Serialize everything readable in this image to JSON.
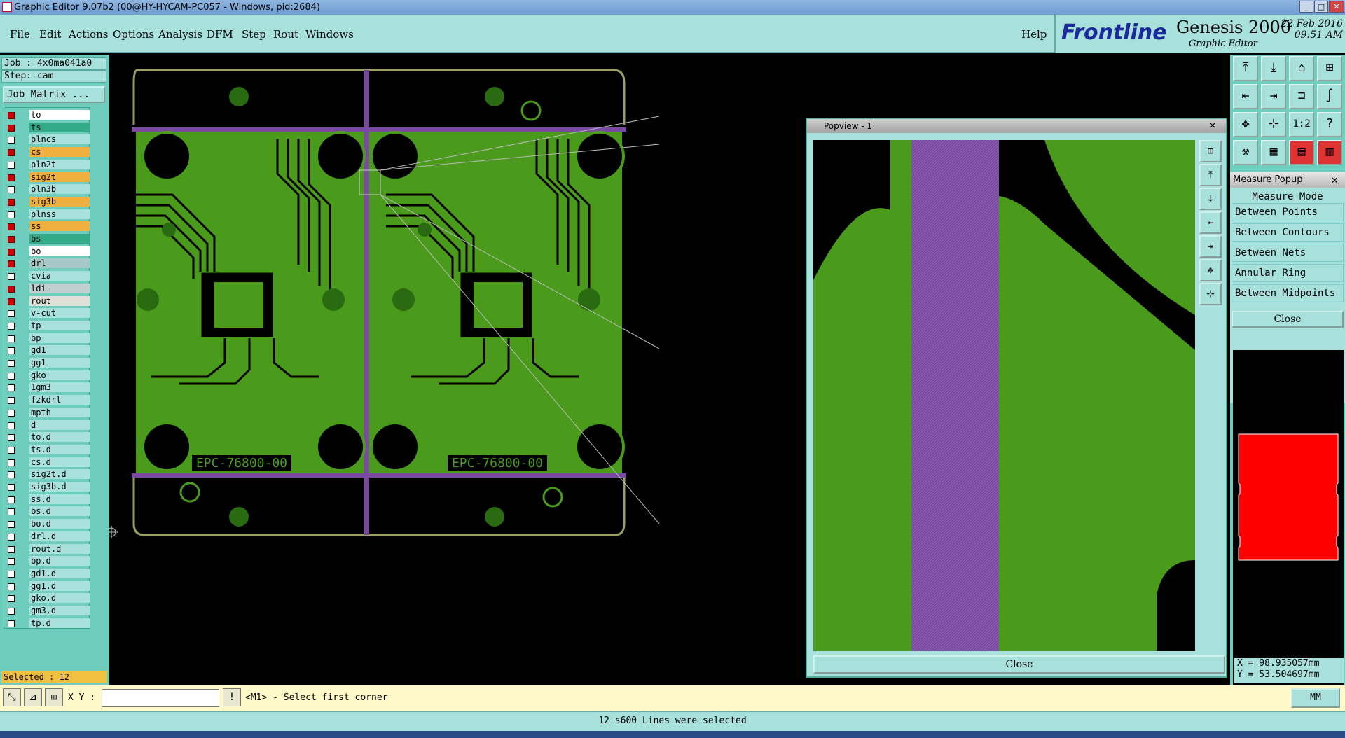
{
  "window": {
    "title": "Graphic Editor 9.07b2 (00@HY-HYCAM-PC057 - Windows, pid:2684)"
  },
  "menu": [
    "File",
    "Edit",
    "Actions",
    "Options",
    "Analysis",
    "DFM",
    "Step",
    "Rout",
    "Windows"
  ],
  "help": "Help",
  "brand": {
    "logo": "Frontline",
    "product": "Genesis 2000",
    "subtitle": "Graphic Editor",
    "date": "22 Feb 2016",
    "time": "09:51 AM"
  },
  "job": {
    "job": "Job : 4x0ma041a0",
    "step": "Step: cam",
    "matrix_btn": "Job Matrix ..."
  },
  "layers": [
    {
      "name": "to",
      "color": "#ffffff",
      "on": true
    },
    {
      "name": "ts",
      "color": "#33aa88",
      "on": true
    },
    {
      "name": "plncs",
      "color": "#a8e0dc",
      "on": false
    },
    {
      "name": "cs",
      "color": "#f0b040",
      "on": true
    },
    {
      "name": "pln2t",
      "color": "#a8e0dc",
      "on": false
    },
    {
      "name": "sig2t",
      "color": "#f0b040",
      "on": true
    },
    {
      "name": "pln3b",
      "color": "#a8e0dc",
      "on": false
    },
    {
      "name": "sig3b",
      "color": "#f0b040",
      "on": true
    },
    {
      "name": "plnss",
      "color": "#a8e0dc",
      "on": false
    },
    {
      "name": "ss",
      "color": "#f0b040",
      "on": true
    },
    {
      "name": "bs",
      "color": "#33aa88",
      "on": true
    },
    {
      "name": "bo",
      "color": "#ffffff",
      "on": true
    },
    {
      "name": "drl",
      "color": "#a8c8c8",
      "on": true
    },
    {
      "name": "cvia",
      "color": "#a8e0dc",
      "on": false
    },
    {
      "name": "ldi",
      "color": "#c0d0d0",
      "on": true
    },
    {
      "name": "rout",
      "color": "#e0e0d8",
      "on": true
    },
    {
      "name": "v-cut",
      "color": "#a8e0dc",
      "on": false
    },
    {
      "name": "tp",
      "color": "#a8e0dc",
      "on": false
    },
    {
      "name": "bp",
      "color": "#a8e0dc",
      "on": false
    },
    {
      "name": "gd1",
      "color": "#a8e0dc",
      "on": false
    },
    {
      "name": "gg1",
      "color": "#a8e0dc",
      "on": false
    },
    {
      "name": "gko",
      "color": "#a8e0dc",
      "on": false
    },
    {
      "name": "1gm3",
      "color": "#a8e0dc",
      "on": false
    },
    {
      "name": "fzkdrl",
      "color": "#a8e0dc",
      "on": false
    },
    {
      "name": "mpth",
      "color": "#a8e0dc",
      "on": false
    },
    {
      "name": "d",
      "color": "#a8e0dc",
      "on": false
    },
    {
      "name": "to.d",
      "color": "#a8e0dc",
      "on": false
    },
    {
      "name": "ts.d",
      "color": "#a8e0dc",
      "on": false
    },
    {
      "name": "cs.d",
      "color": "#a8e0dc",
      "on": false
    },
    {
      "name": "sig2t.d",
      "color": "#a8e0dc",
      "on": false
    },
    {
      "name": "sig3b.d",
      "color": "#a8e0dc",
      "on": false
    },
    {
      "name": "ss.d",
      "color": "#a8e0dc",
      "on": false
    },
    {
      "name": "bs.d",
      "color": "#a8e0dc",
      "on": false
    },
    {
      "name": "bo.d",
      "color": "#a8e0dc",
      "on": false
    },
    {
      "name": "drl.d",
      "color": "#a8e0dc",
      "on": false
    },
    {
      "name": "rout.d",
      "color": "#a8e0dc",
      "on": false
    },
    {
      "name": "bp.d",
      "color": "#a8e0dc",
      "on": false
    },
    {
      "name": "gd1.d",
      "color": "#a8e0dc",
      "on": false
    },
    {
      "name": "gg1.d",
      "color": "#a8e0dc",
      "on": false
    },
    {
      "name": "gko.d",
      "color": "#a8e0dc",
      "on": false
    },
    {
      "name": "gm3.d",
      "color": "#a8e0dc",
      "on": false
    },
    {
      "name": "tp.d",
      "color": "#a8e0dc",
      "on": false
    }
  ],
  "selected": "Selected : 12",
  "board_label": "EPC-76800-00",
  "popview": {
    "title": "Popview - 1",
    "close": "Close"
  },
  "measure": {
    "title": "Measure Popup",
    "mode_label": "Measure Mode",
    "modes": [
      "Between Points",
      "Between Contours",
      "Between Nets",
      "Annular Ring",
      "Between Midpoints"
    ],
    "close": "Close"
  },
  "coords": {
    "x": "X = 98.935057mm",
    "y": "Y = 53.504697mm"
  },
  "bottom": {
    "xy_label": "X Y :",
    "xy_value": "",
    "prompt": "<M1> - Select first corner",
    "units": "MM"
  },
  "status": "12 s600 Lines were selected"
}
